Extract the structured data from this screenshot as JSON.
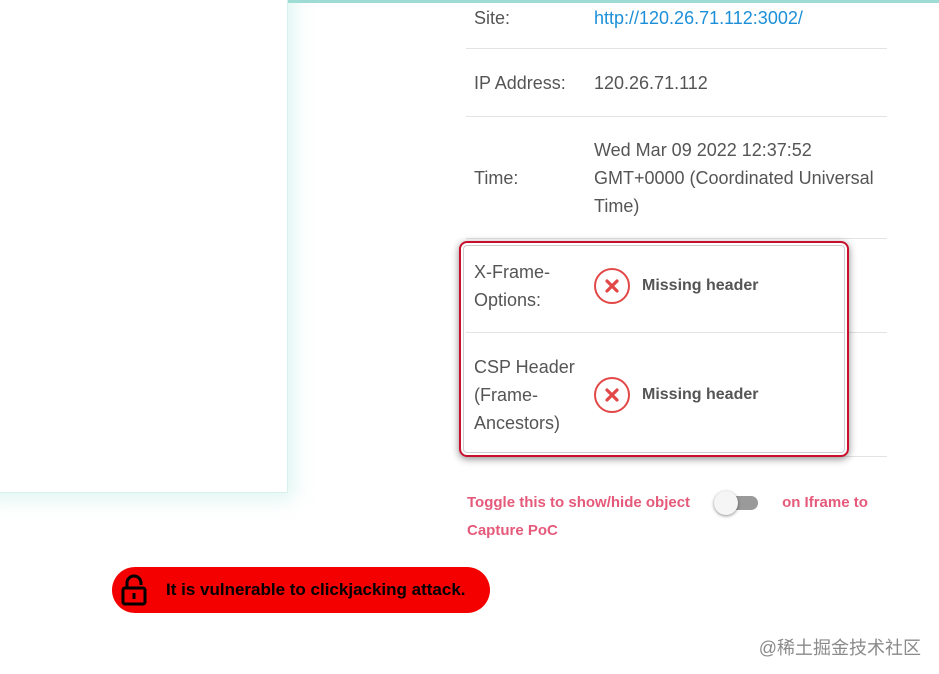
{
  "info": {
    "site_label": "Site:",
    "site_value": "http://120.26.71.112:3002/",
    "ip_label": "IP Address:",
    "ip_value": "120.26.71.112",
    "time_label": "Time:",
    "time_value": "Wed Mar 09 2022 12:37:52 GMT+0000 (Coordinated Universal Time)"
  },
  "headers": {
    "xfo_label": "X-Frame-Options:",
    "xfo_status": "Missing header",
    "csp_label": "CSP Header (Frame-Ancestors)",
    "csp_status": "Missing header"
  },
  "toggle": {
    "text_before": "Toggle this to show/hide object",
    "text_after": "on Iframe to",
    "text_wrap": "Capture PoC",
    "checked": false
  },
  "alert": {
    "message": "It is vulnerable to clickjacking attack."
  },
  "watermark": "@稀土掘金技术社区",
  "colors": {
    "link": "#1c8fd8",
    "error": "#e24848",
    "highlight_border": "#c8102e",
    "toggle_text": "#e55a7a",
    "alert_bg": "#f40000"
  },
  "icons": [
    "x-circle-icon",
    "lock-icon"
  ]
}
